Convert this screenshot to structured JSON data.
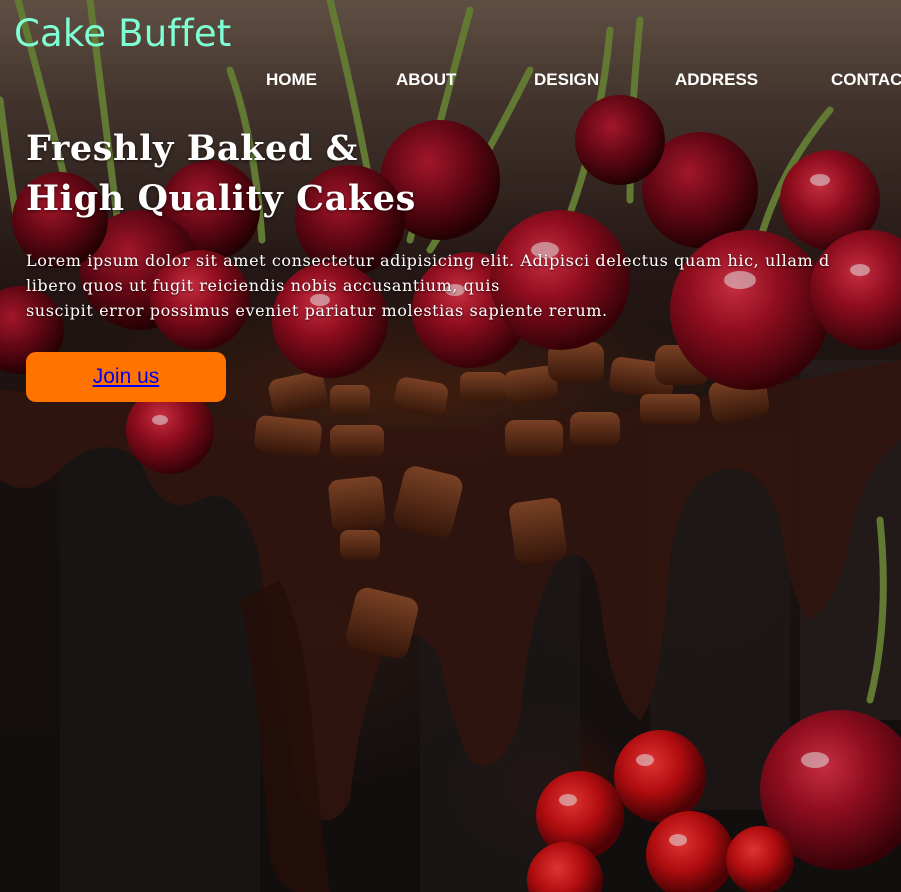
{
  "header": {
    "logo_text": "Cake Buffet"
  },
  "nav": {
    "items": [
      "HOME",
      "ABOUT",
      "DESIGN",
      "ADDRESS",
      "CONTAC"
    ]
  },
  "hero": {
    "headline_line1": "Freshly Baked &",
    "headline_line2": "High Quality Cakes",
    "paragraph_line1": "Lorem ipsum dolor sit amet consectetur adipisicing elit. Adipisci delectus quam hic, ullam d",
    "paragraph_line2": "libero quos ut fugit reiciendis nobis accusantium, quis",
    "paragraph_line3": "suscipit error possimus eveniet pariatur molestias sapiente rerum.",
    "cta_label": "Join us"
  },
  "colors": {
    "logo": "#7fffd4",
    "cta_background": "#ff7400",
    "cta_text": "#0000ee",
    "nav_text": "#ffffff"
  }
}
